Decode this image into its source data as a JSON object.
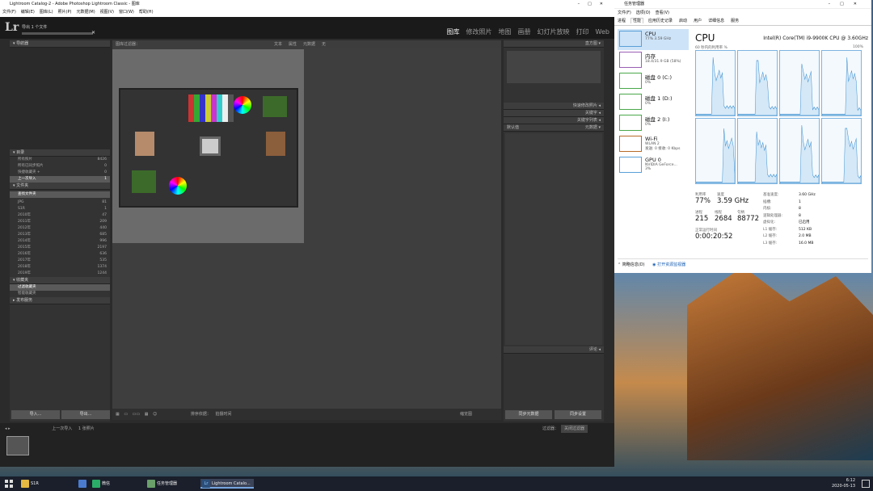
{
  "lightroom": {
    "window_title": "Lightroom Catalog-2 - Adobe Photoshop Lightroom Classic - 图库",
    "menu": [
      "文件(F)",
      "编辑(E)",
      "图库(L)",
      "照片(P)",
      "元数据(M)",
      "视图(V)",
      "窗口(W)",
      "帮助(H)"
    ],
    "logo": "Lr",
    "export_status": "导出 1 个文件",
    "modules": [
      "图库",
      "修改照片",
      "地图",
      "画册",
      "幻灯片放映",
      "打印",
      "Web"
    ],
    "active_module": "图库",
    "navigator": "导航器",
    "catalog_label": "目录",
    "catalog_rows": [
      {
        "label": "所有照片",
        "count": "8426"
      },
      {
        "label": "所有已同步照片",
        "count": "0"
      },
      {
        "label": "快捷收藏夹 +",
        "count": "0"
      },
      {
        "label": "上一次导入",
        "count": "1"
      }
    ],
    "folders_label": "文件夹",
    "find_folder": "查找文件夹",
    "folders": [
      {
        "label": "JPG",
        "count": "81"
      },
      {
        "label": "S1R",
        "count": "1"
      },
      {
        "label": "2010年",
        "count": "47"
      },
      {
        "label": "2011年",
        "count": "209"
      },
      {
        "label": "2012年",
        "count": "440"
      },
      {
        "label": "2013年",
        "count": "685"
      },
      {
        "label": "2014年",
        "count": "996"
      },
      {
        "label": "2015年",
        "count": "2197"
      },
      {
        "label": "2016年",
        "count": "636"
      },
      {
        "label": "2017年",
        "count": "535"
      },
      {
        "label": "2018年",
        "count": "1374"
      },
      {
        "label": "2019年",
        "count": "1244"
      }
    ],
    "collections_label": "收藏夹",
    "filter_collections": "过滤收藏夹",
    "smart_collections": "智能收藏夹",
    "publish_label": "发布服务",
    "library_filter": "图库过滤器：",
    "filter_tabs": [
      "文本",
      "属性",
      "元数据",
      "无"
    ],
    "quick_develop": "快速修改照片",
    "keywords": "关键字",
    "keyword_list": "关键字列表",
    "metadata": "元数据",
    "comments": "评论",
    "default": "默认值",
    "import_btn": "导入...",
    "export_btn": "导出...",
    "sync_meta": "同步元数据",
    "sync_settings": "同步设置",
    "sort_label": "排序依据：",
    "sort_value": "拍摄时间",
    "thumbnails": "缩览图",
    "last_import": "上一次导入",
    "photo_count": "1 张照片",
    "filter_label": "过滤器：",
    "filter_value": "关闭过滤器"
  },
  "taskmanager": {
    "title": "任务管理器",
    "menu": [
      "文件(F)",
      "选项(O)",
      "查看(V)"
    ],
    "tabs": [
      "进程",
      "性能",
      "应用历史记录",
      "启动",
      "用户",
      "详细信息",
      "服务"
    ],
    "active_tab": "性能",
    "items": [
      {
        "name": "CPU",
        "sub": "77% 3.59 GHz"
      },
      {
        "name": "内存",
        "sub": "18.4/31.9 GB (58%)"
      },
      {
        "name": "磁盘 0 (C:)",
        "sub": "0%"
      },
      {
        "name": "磁盘 1 (D:)",
        "sub": "0%"
      },
      {
        "name": "磁盘 2 (I:)",
        "sub": "0%"
      },
      {
        "name": "Wi-Fi",
        "sub": "WLAN 2",
        "sub2": "发送: 0 接收: 0 Kbps"
      },
      {
        "name": "GPU 0",
        "sub": "NVIDIA GeForce...",
        "sub2": "3%"
      }
    ],
    "cpu_title": "CPU",
    "cpu_model": "Intel(R) Core(TM) i9-9900K CPU @ 3.60GHz",
    "graph_label": "60 秒内的利用率 %",
    "graph_max": "100%",
    "utilization_label": "利用率",
    "utilization": "77%",
    "speed_label": "速度",
    "speed": "3.59 GHz",
    "processes_label": "进程",
    "processes": "215",
    "threads_label": "线程",
    "threads": "2684",
    "handles_label": "句柄",
    "handles": "88772",
    "uptime_label": "正常运行时间",
    "uptime": "0:00:20:52",
    "specs": [
      {
        "k": "基准速度:",
        "v": "3.60 GHz"
      },
      {
        "k": "插槽:",
        "v": "1"
      },
      {
        "k": "内核:",
        "v": "8"
      },
      {
        "k": "逻辑处理器:",
        "v": "8"
      },
      {
        "k": "虚拟化:",
        "v": "已启用"
      },
      {
        "k": "L1 缓存:",
        "v": "512 KB"
      },
      {
        "k": "L2 缓存:",
        "v": "2.0 MB"
      },
      {
        "k": "L3 缓存:",
        "v": "16.0 MB"
      }
    ],
    "fewer": "简略信息(D)",
    "open_monitor": "打开资源监视器"
  },
  "taskbar": {
    "items": [
      "S1R",
      "微信",
      "任务管理器",
      "Lightroom Catalo..."
    ],
    "time": "6:12",
    "date": "2020-05-13"
  }
}
